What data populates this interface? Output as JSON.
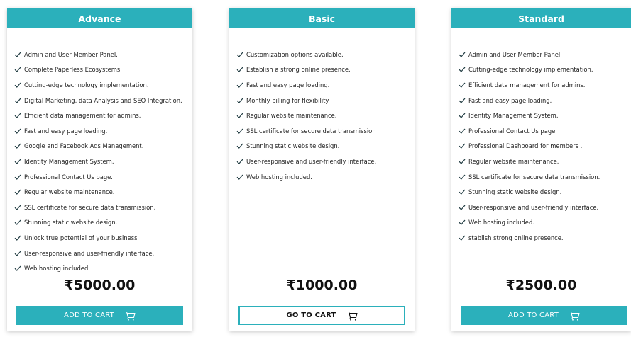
{
  "colors": {
    "accent": "#2bb0bb",
    "check": "#1f3a40"
  },
  "icons": {
    "feature": "checkmark-icon",
    "button": "shopping-cart-icon"
  },
  "plans": [
    {
      "name": "Advance",
      "features": [
        "Admin and User Member Panel.",
        "Complete Paperless Ecosystems.",
        "Cutting-edge technology implementation.",
        "Digital Marketing, data Analysis and SEO Integration.",
        "Efficient data management for admins.",
        "Fast and easy page loading.",
        "Google and Facebook Ads Management.",
        "Identity Management System.",
        "Professional Contact Us page.",
        "Regular website maintenance.",
        "SSL certificate for secure data transmission.",
        "Stunning static website design.",
        "Unlock true potential of your business",
        "User-responsive and user-friendly interface.",
        "Web hosting included."
      ],
      "price": "₹5000.00",
      "button_label": "ADD TO CART",
      "button_style": "filled"
    },
    {
      "name": "Basic",
      "features": [
        "Customization options available.",
        "Establish a strong online presence.",
        "Fast and easy page loading.",
        "Monthly billing for flexibility.",
        "Regular website maintenance.",
        "SSL certificate for secure data transmission",
        "Stunning static website design.",
        "User-responsive and user-friendly interface.",
        "Web hosting included."
      ],
      "price": "₹1000.00",
      "button_label": "GO TO CART",
      "button_style": "outline"
    },
    {
      "name": "Standard",
      "features": [
        "Admin and User Member Panel.",
        "Cutting-edge technology implementation.",
        "Efficient data management for admins.",
        "Fast and easy page loading.",
        "Identity Management System.",
        "Professional Contact Us page.",
        "Professional Dashboard for members .",
        "Regular website maintenance.",
        "SSL certificate for secure data transmission.",
        "Stunning static website design.",
        "User-responsive and user-friendly interface.",
        "Web hosting included.",
        "stablish strong online presence."
      ],
      "price": "₹2500.00",
      "button_label": "ADD TO CART",
      "button_style": "filled"
    }
  ]
}
